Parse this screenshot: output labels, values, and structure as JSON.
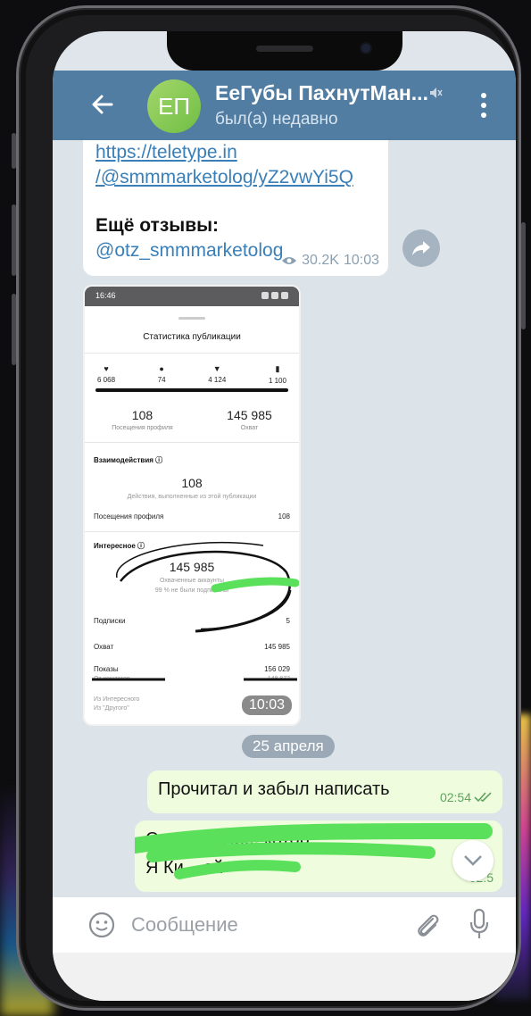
{
  "header": {
    "avatar_initials": "ЕП",
    "title": "ЕеГубы ПахнутМан...",
    "status": "был(а) недавно"
  },
  "message_in": {
    "link_line1": "https://teletype.in",
    "link_line2": "/@smmmarketolog/yZ2vwYi5Q",
    "more_title": "Ещё отзывы:",
    "handle": "@otz_smmmarketolog",
    "views": "30.2K",
    "time": "10:03"
  },
  "image_message": {
    "status_time": "16:46",
    "heading": "Статистика публикации",
    "stats": [
      {
        "icon": "♥",
        "value": "6 068"
      },
      {
        "icon": "●",
        "value": "74"
      },
      {
        "icon": "▼",
        "value": "4 124"
      },
      {
        "icon": "▮",
        "value": "1 100"
      }
    ],
    "visits_value": "108",
    "visits_caption": "Посещения профиля",
    "reach_value": "145 985",
    "reach_caption": "Охват",
    "interactions_title": "Взаимодействия ⓘ",
    "interactions_value": "108",
    "interactions_caption": "Действия, выполненные из этой публикации",
    "profile_visits_label": "Посещения профиля",
    "profile_visits_value": "108",
    "interesting_title": "Интересное ⓘ",
    "interesting_value": "145 985",
    "interesting_caption": "Охваченные аккаунты",
    "not_followers": "99 % не были подписаны",
    "subs_label": "Подписки",
    "subs_value": "5",
    "reach_label": "Охват",
    "reach_row_value": "145 985",
    "impressions_label": "Показы",
    "impressions_value": "156 029",
    "hashtags_label": "От хештегов",
    "hashtags_value": "148 872",
    "explore_label": "Из Интересного",
    "other_label": "Из \"Другого\"",
    "time": "10:03"
  },
  "date_divider": "25 апреля",
  "message_out_1": {
    "text": "Прочитал и забыл написать",
    "time": "02:54"
  },
  "message_out_2": {
    "text_line1": "Сто пока ли... котор",
    "text_line2": "Я Ки... ей",
    "time": "02:5"
  },
  "input": {
    "placeholder": "Сообщение"
  }
}
